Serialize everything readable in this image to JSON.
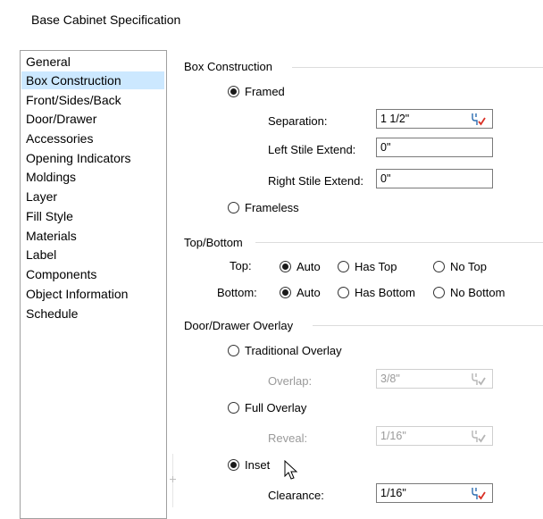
{
  "window": {
    "title": "Base Cabinet Specification"
  },
  "sidebar": {
    "items": [
      {
        "label": "General",
        "selected": false
      },
      {
        "label": "Box Construction",
        "selected": true
      },
      {
        "label": "Front/Sides/Back",
        "selected": false
      },
      {
        "label": "Door/Drawer",
        "selected": false
      },
      {
        "label": "Accessories",
        "selected": false
      },
      {
        "label": "Opening Indicators",
        "selected": false
      },
      {
        "label": "Moldings",
        "selected": false
      },
      {
        "label": "Layer",
        "selected": false
      },
      {
        "label": "Fill Style",
        "selected": false
      },
      {
        "label": "Materials",
        "selected": false
      },
      {
        "label": "Label",
        "selected": false
      },
      {
        "label": "Components",
        "selected": false
      },
      {
        "label": "Object Information",
        "selected": false
      },
      {
        "label": "Schedule",
        "selected": false
      }
    ]
  },
  "box_construction": {
    "group_label": "Box Construction",
    "framed_label": "Framed",
    "framed_checked": true,
    "separation_label": "Separation:",
    "separation_value": "1 1/2\"",
    "left_stile_label": "Left Stile Extend:",
    "left_stile_value": "0\"",
    "right_stile_label": "Right Stile Extend:",
    "right_stile_value": "0\"",
    "frameless_label": "Frameless",
    "frameless_checked": false
  },
  "top_bottom": {
    "group_label": "Top/Bottom",
    "top_label": "Top:",
    "top_auto": "Auto",
    "top_has": "Has Top",
    "top_no": "No Top",
    "bottom_label": "Bottom:",
    "bottom_auto": "Auto",
    "bottom_has": "Has Bottom",
    "bottom_no": "No Bottom"
  },
  "overlay": {
    "group_label": "Door/Drawer Overlay",
    "traditional_label": "Traditional Overlay",
    "overlap_label": "Overlap:",
    "overlap_value": "3/8\"",
    "full_label": "Full Overlay",
    "reveal_label": "Reveal:",
    "reveal_value": "1/16\"",
    "inset_label": "Inset",
    "inset_checked": true,
    "clearance_label": "Clearance:",
    "clearance_value": "1/16\""
  },
  "icons": {
    "measure_tool": "measure-tool-icon",
    "cursor": "mouse-pointer-icon"
  },
  "colors": {
    "selection": "#cce8ff",
    "check_mark": "#d93025",
    "tool_blue": "#2b6cb0"
  }
}
